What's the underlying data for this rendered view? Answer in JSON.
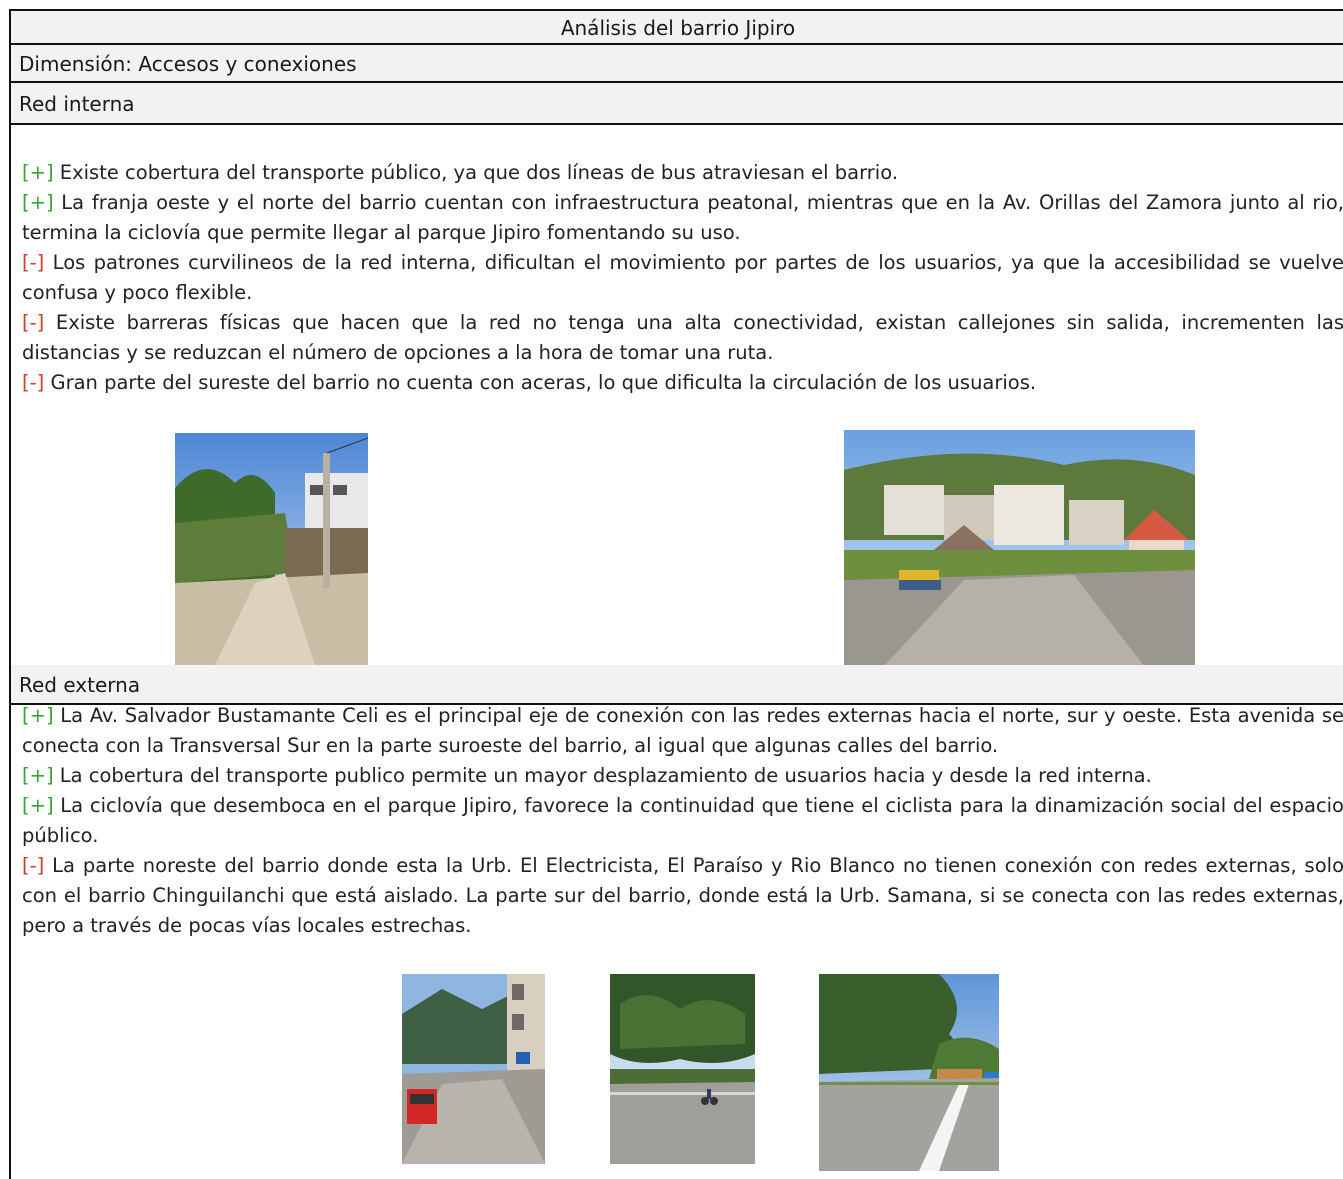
{
  "document": {
    "title": "Análisis del barrio Jipiro",
    "dimension": "Dimensión: Accesos y conexiones"
  },
  "red_interna": {
    "heading": "Red interna",
    "items": [
      {
        "sign": "[+]",
        "text": " Existe cobertura del transporte público, ya que dos líneas de bus atraviesan el barrio."
      },
      {
        "sign": "[+]",
        "text": " La franja oeste y el norte del barrio cuentan con infraestructura peatonal, mientras que en la Av. Orillas del Zamora junto al rio, termina la ciclovía que permite llegar al parque Jipiro fomentando su uso."
      },
      {
        "sign": "[-]",
        "text": " Los patrones curvilineos de la red interna, dificultan el movimiento por partes de los usuarios, ya que la accesibilidad se vuelve confusa y poco flexible."
      },
      {
        "sign": "[-]",
        "text": " Existe barreras físicas que hacen que la red no tenga una alta conectividad, existan callejones sin salida, incrementen las distancias y se reduzcan el número de opciones a la hora de tomar una ruta."
      },
      {
        "sign": "[-]",
        "text": " Gran parte del sureste del barrio no cuenta con aceras, lo que dificulta la circulación de los usuarios."
      }
    ]
  },
  "red_externa": {
    "heading": "Red externa",
    "items": [
      {
        "sign": "[+]",
        "text": " La Av. Salvador Bustamante Celi es el principal eje de conexión con las redes externas hacia el norte, sur y oeste. Esta avenida se conecta con la Transversal Sur en la parte suroeste del barrio, al igual que algunas calles del barrio."
      },
      {
        "sign": "[+]",
        "text": " La cobertura del transporte publico permite un mayor desplazamiento de usuarios hacia y desde la red interna."
      },
      {
        "sign": "[+]",
        "text": " La ciclovía que desemboca en el parque Jipiro, favorece la continuidad que tiene el ciclista para la dinamización social del espacio público."
      },
      {
        "sign": "[-]",
        "text": " La parte noreste del barrio donde esta la Urb. El Electricista, El Paraíso y Rio Blanco no tienen conexión con redes externas, solo con el barrio Chinguilanchi que está aislado. La parte sur del barrio, donde está la Urb. Samana, si se conecta con las redes externas, pero a través de pocas vías locales estrechas."
      }
    ]
  },
  "colors": {
    "positive": "#36a336",
    "negative": "#d03a2a",
    "header_bg": "#f2f2f2"
  }
}
